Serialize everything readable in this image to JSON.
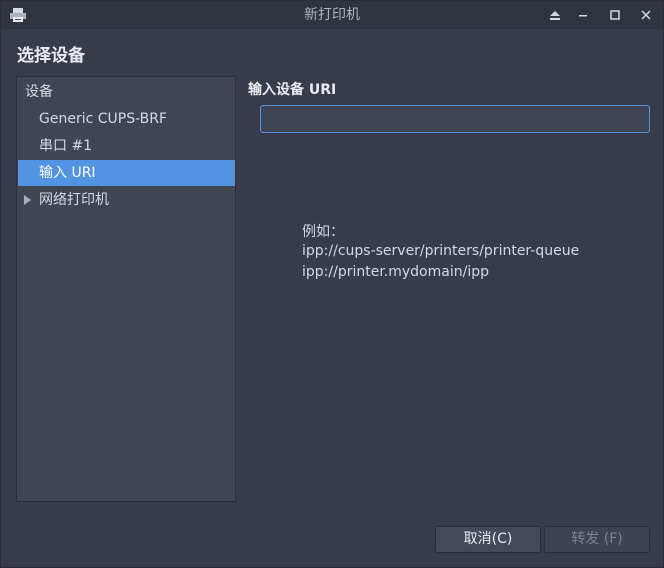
{
  "window": {
    "title": "新打印机",
    "controls": [
      "eject-icon",
      "minimize-icon",
      "maximize-icon",
      "close-icon"
    ]
  },
  "page": {
    "heading": "选择设备"
  },
  "device_tree": {
    "header": "设备",
    "items": [
      {
        "label": "Generic CUPS-BRF",
        "selected": false
      },
      {
        "label": "串口 #1",
        "selected": false
      },
      {
        "label": "输入 URI",
        "selected": true
      },
      {
        "label": "网络打印机",
        "selected": false,
        "expandable": true
      }
    ]
  },
  "uri_section": {
    "label": "输入设备 URI",
    "input_value": "",
    "example_heading": "例如：",
    "examples": [
      "ipp://cups-server/printers/printer-queue",
      "ipp://printer.mydomain/ipp"
    ]
  },
  "buttons": {
    "cancel": "取消(C)",
    "forward": "转发 (F)"
  },
  "colors": {
    "accent": "#5294e2",
    "window_bg": "#383c4a",
    "titlebar_bg": "#2f343f",
    "tree_bg": "#404552"
  }
}
